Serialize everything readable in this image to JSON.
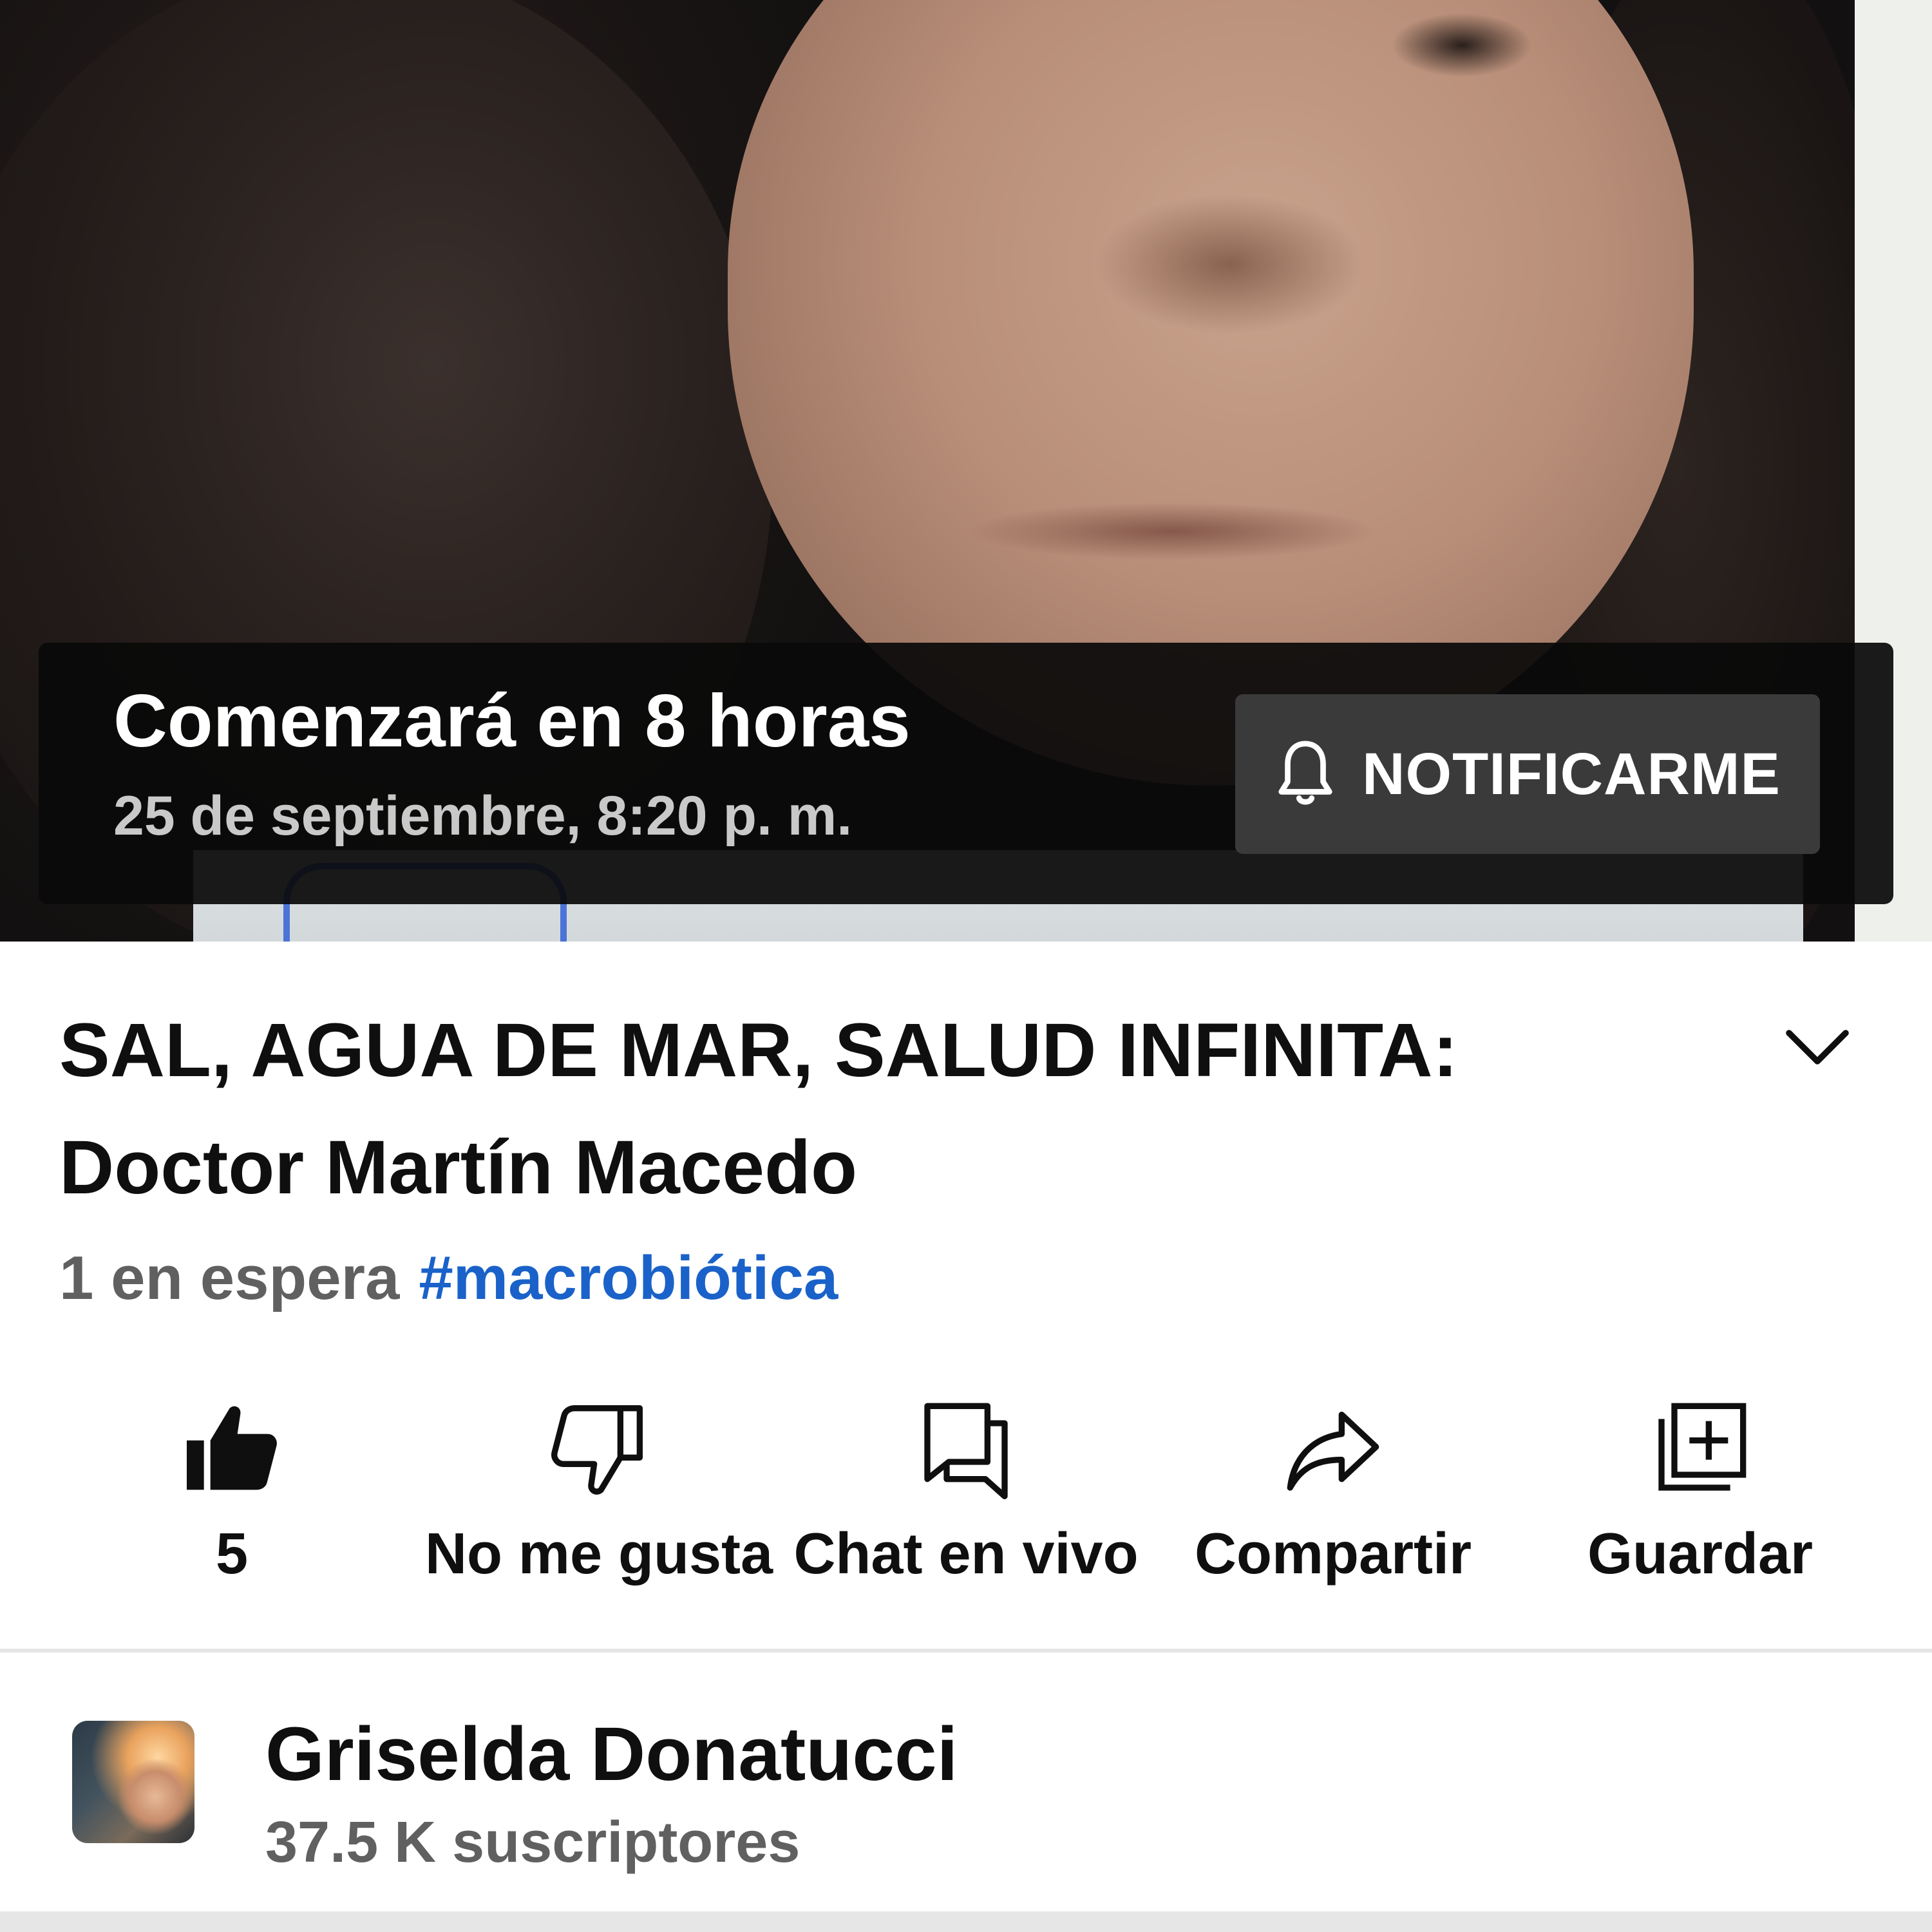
{
  "player": {
    "starts_in": "Comenzará en 8 horas",
    "scheduled_date": "25 de septiembre, 8:20 p. m.",
    "notify_label": "NOTIFICARME",
    "notify_icon": "bell-icon"
  },
  "video": {
    "title": "SAL, AGUA DE MAR, SALUD INFINITA: Doctor Martín Macedo",
    "waiting": "1 en espera",
    "hashtag": "#macrobiótica"
  },
  "actions": [
    {
      "icon": "thumbs-up-icon",
      "label": "5"
    },
    {
      "icon": "thumbs-down-icon",
      "label": "No me gusta"
    },
    {
      "icon": "live-chat-icon",
      "label": "Chat en vivo"
    },
    {
      "icon": "share-icon",
      "label": "Compartir"
    },
    {
      "icon": "save-to-playlist-icon",
      "label": "Guardar"
    }
  ],
  "channel": {
    "name": "Griselda Donatucci",
    "subscribers": "37.5 K suscriptores"
  },
  "colors": {
    "hashtag": "#1a62c9",
    "secondary_text": "#606060",
    "banner_bg": "#0a0a0a",
    "notify_bg": "#3a3a3a"
  }
}
